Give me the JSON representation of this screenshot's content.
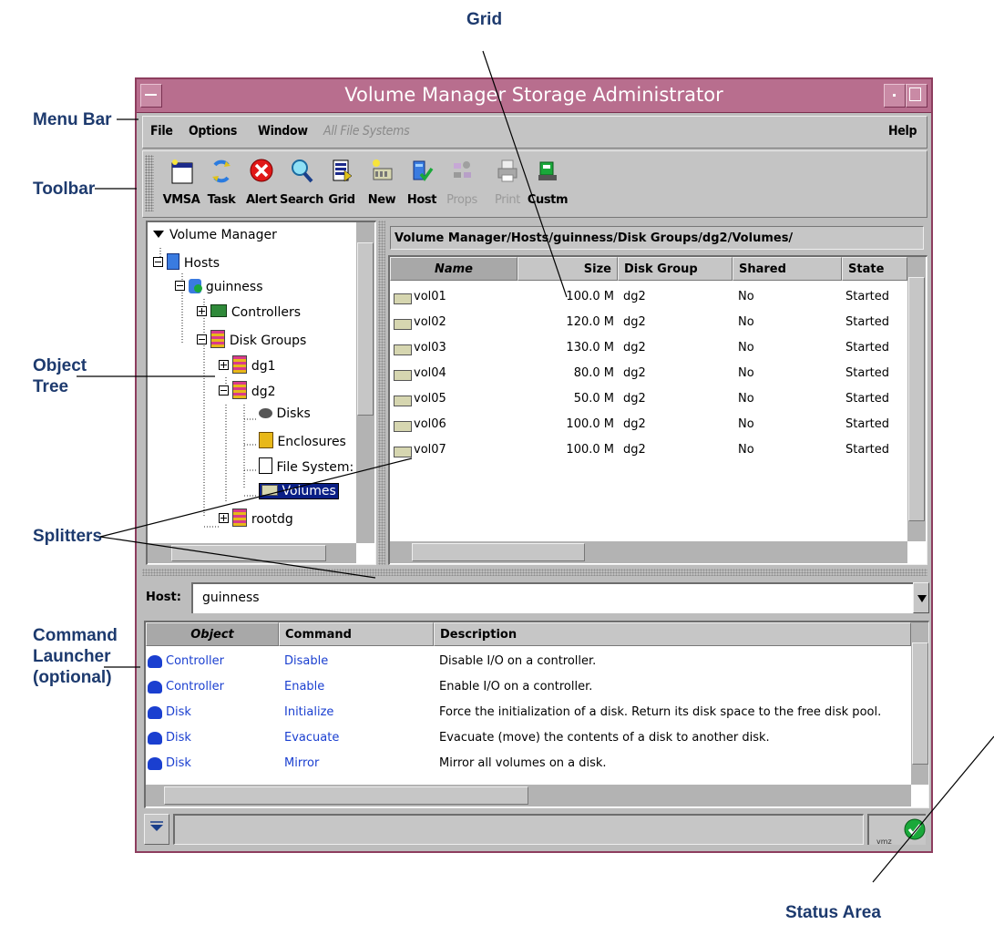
{
  "callouts": {
    "grid": "Grid",
    "menu_bar": "Menu Bar",
    "toolbar": "Toolbar",
    "object_tree_1": "Object",
    "object_tree_2": "Tree",
    "splitters": "Splitters",
    "command_1": "Command",
    "command_2": "Launcher",
    "command_3": "(optional)",
    "status_area": "Status Area"
  },
  "window": {
    "title": "Volume Manager Storage Administrator"
  },
  "menu": {
    "file": "File",
    "options": "Options",
    "window": "Window",
    "all_fs": "All File Systems",
    "help": "Help"
  },
  "toolbar": {
    "buttons": [
      {
        "label": "VMSA",
        "icon": "vmsa-icon"
      },
      {
        "label": "Task",
        "icon": "task-icon"
      },
      {
        "label": "Alert",
        "icon": "alert-icon"
      },
      {
        "label": "Search",
        "icon": "search-icon"
      },
      {
        "label": "Grid",
        "icon": "grid-icon"
      },
      {
        "label": "New",
        "icon": "new-icon"
      },
      {
        "label": "Host",
        "icon": "host-icon"
      },
      {
        "label": "Props",
        "icon": "props-icon"
      },
      {
        "label": "Print",
        "icon": "print-icon"
      },
      {
        "label": "Custm",
        "icon": "custom-icon"
      }
    ]
  },
  "tree": {
    "items": [
      {
        "label": "Volume Manager"
      },
      {
        "label": "Hosts"
      },
      {
        "label": "guinness"
      },
      {
        "label": "Controllers"
      },
      {
        "label": "Disk Groups"
      },
      {
        "label": "dg1"
      },
      {
        "label": "dg2"
      },
      {
        "label": "Disks"
      },
      {
        "label": "Enclosures"
      },
      {
        "label": "File System:"
      },
      {
        "label": "Volumes"
      },
      {
        "label": "rootdg"
      }
    ]
  },
  "grid": {
    "path": "Volume Manager/Hosts/guinness/Disk Groups/dg2/Volumes/",
    "columns": [
      "Name",
      "Size",
      "Disk Group",
      "Shared",
      "State"
    ],
    "rows": [
      {
        "name": "vol01",
        "size": "100.0 M",
        "dg": "dg2",
        "shared": "No",
        "state": "Started"
      },
      {
        "name": "vol02",
        "size": "120.0 M",
        "dg": "dg2",
        "shared": "No",
        "state": "Started"
      },
      {
        "name": "vol03",
        "size": "130.0 M",
        "dg": "dg2",
        "shared": "No",
        "state": "Started"
      },
      {
        "name": "vol04",
        "size": "80.0 M",
        "dg": "dg2",
        "shared": "No",
        "state": "Started"
      },
      {
        "name": "vol05",
        "size": "50.0 M",
        "dg": "dg2",
        "shared": "No",
        "state": "Started"
      },
      {
        "name": "vol06",
        "size": "100.0 M",
        "dg": "dg2",
        "shared": "No",
        "state": "Started"
      },
      {
        "name": "vol07",
        "size": "100.0 M",
        "dg": "dg2",
        "shared": "No",
        "state": "Started"
      }
    ]
  },
  "host": {
    "label": "Host:",
    "value": "guinness"
  },
  "commands": {
    "columns": [
      "Object",
      "Command",
      "Description"
    ],
    "rows": [
      {
        "object": "Controller",
        "command": "Disable",
        "description": "Disable I/O on a controller."
      },
      {
        "object": "Controller",
        "command": "Enable",
        "description": "Enable I/O on a controller."
      },
      {
        "object": "Disk",
        "command": "Initialize",
        "description": "Force the initialization of a disk. Return its disk space to the free disk pool."
      },
      {
        "object": "Disk",
        "command": "Evacuate",
        "description": "Evacuate (move) the contents of a disk to another disk."
      },
      {
        "object": "Disk",
        "command": "Mirror",
        "description": "Mirror all volumes on a disk."
      }
    ]
  },
  "status": {
    "indicator": "ok-check-icon",
    "fragment": "vmz"
  },
  "colors": {
    "title_bar": "#b86e8e",
    "frame": "#8d3d5e",
    "callout_text": "#1d3a6e",
    "link_blue": "#1a3fd0",
    "selection": "#0a1f86"
  }
}
